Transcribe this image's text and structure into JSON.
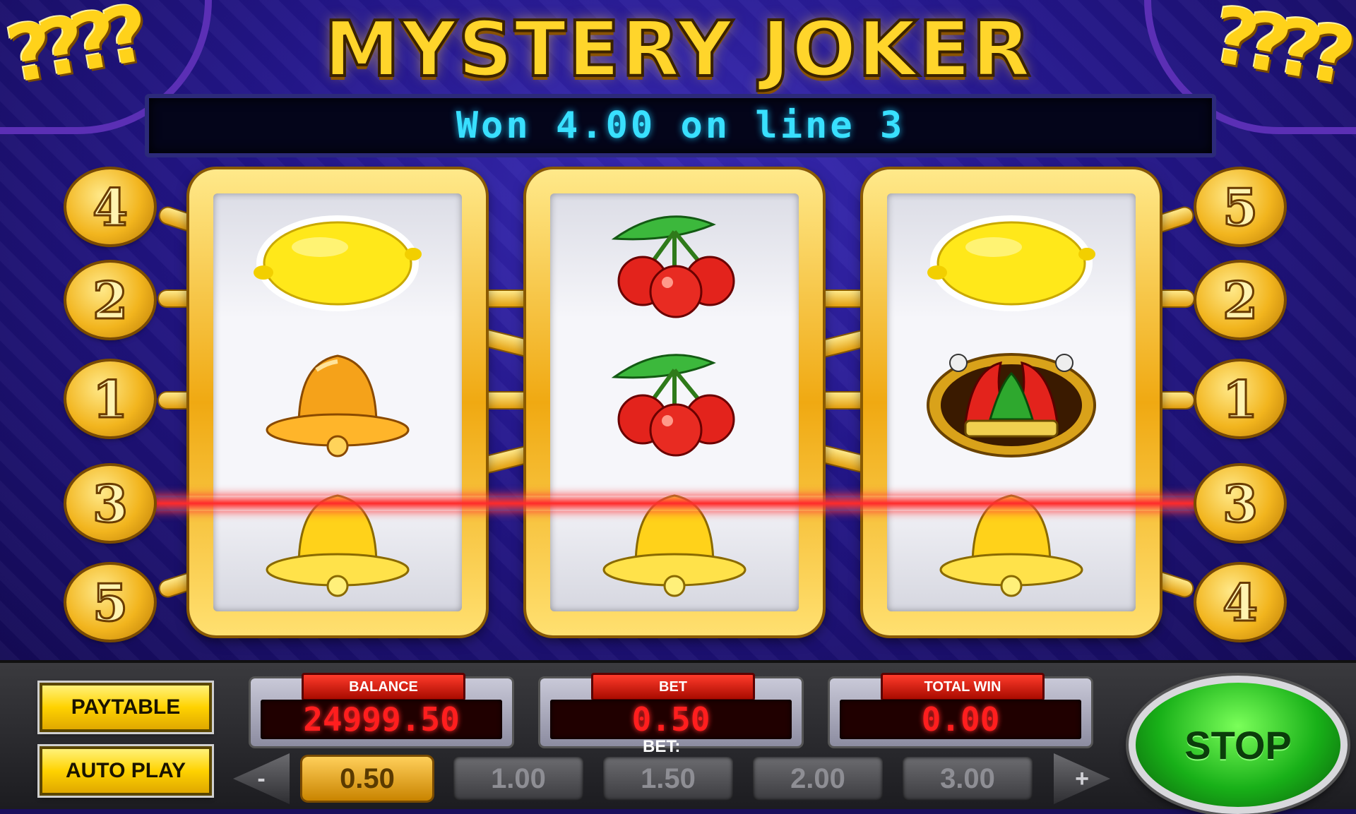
{
  "title": "MYSTERY JOKER",
  "message": "Won 4.00 on line 3",
  "reels": [
    {
      "symbols": [
        "lemon",
        "bell",
        "bell"
      ]
    },
    {
      "symbols": [
        "cherries",
        "cherries",
        "bell"
      ]
    },
    {
      "symbols": [
        "lemon",
        "joker",
        "bell"
      ]
    }
  ],
  "line_badges_left": [
    "4",
    "2",
    "1",
    "3",
    "5"
  ],
  "line_badges_right": [
    "5",
    "2",
    "1",
    "3",
    "4"
  ],
  "winning_line": "3",
  "balance": {
    "label": "BALANCE",
    "value": "24999.50"
  },
  "bet_display": {
    "label": "BET",
    "value": "0.50"
  },
  "total_win": {
    "label": "TOTAL WIN",
    "value": "0.00"
  },
  "buttons": {
    "paytable": "PAYTABLE",
    "auto_play": "AUTO PLAY",
    "stop": "STOP",
    "bet_decrease": "-",
    "bet_increase": "+"
  },
  "bet_selector": {
    "label": "BET:",
    "options": [
      "0.50",
      "1.00",
      "1.50",
      "2.00",
      "3.00"
    ],
    "selected": "0.50"
  },
  "colors": {
    "lcd_text": "#ff1e1e",
    "message_text": "#39e0ff",
    "payline": "#ff2a2a",
    "stop_button": "#18b018"
  }
}
